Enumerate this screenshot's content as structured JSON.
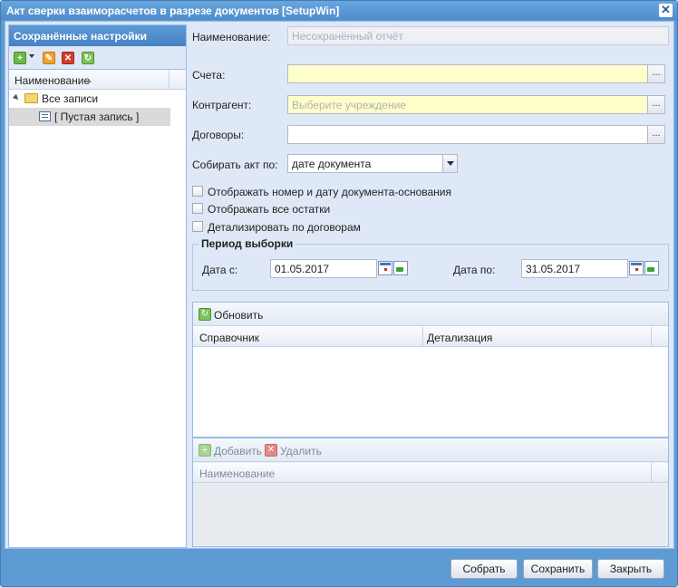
{
  "window": {
    "title": "Акт сверки взаиморасчетов в разрезе документов [SetupWin]",
    "close_glyph": "✕"
  },
  "left": {
    "header": "Сохранённые настройки",
    "toolbar": {
      "add_icon": "add-icon",
      "edit_icon": "edit-icon",
      "delete_icon": "delete-icon",
      "refresh_icon": "refresh-icon"
    },
    "column_header": "Наименование",
    "tree": {
      "root_label": "Все записи",
      "child_label": "[ Пустая запись ]"
    }
  },
  "form": {
    "name": {
      "label": "Наименование:",
      "value": "Несохранённый отчёт"
    },
    "accounts": {
      "label": "Счета:",
      "value": "",
      "trigger": "..."
    },
    "counterparty": {
      "label": "Контрагент:",
      "placeholder": "Выберите учреждение",
      "trigger": "..."
    },
    "contracts": {
      "label": "Договоры:",
      "value": "",
      "trigger": "..."
    },
    "collect_by": {
      "label": "Собирать акт по:",
      "value": "дате документа"
    },
    "checkboxes": [
      {
        "label": "Отображать номер и дату документа-основания",
        "checked": false
      },
      {
        "label": "Отображать все остатки",
        "checked": false
      },
      {
        "label": "Детализировать по договорам",
        "checked": false
      }
    ],
    "period": {
      "legend": "Период выборки",
      "from_label": "Дата с:",
      "from_value": "01.05.2017",
      "to_label": "Дата по:",
      "to_value": "31.05.2017"
    }
  },
  "grid1": {
    "refresh_label": "Обновить",
    "columns": [
      "Справочник",
      "Детализация"
    ]
  },
  "grid2": {
    "add_label": "Добавить",
    "delete_label": "Удалить",
    "columns": [
      "Наименование"
    ]
  },
  "footer": {
    "collect_label": "Собрать",
    "save_label": "Сохранить",
    "close_label": "Закрыть"
  },
  "colors": {
    "window_frame": "#5d9bd4",
    "panel_bg": "#dfe8f6",
    "required_field": "#ffffcc"
  }
}
